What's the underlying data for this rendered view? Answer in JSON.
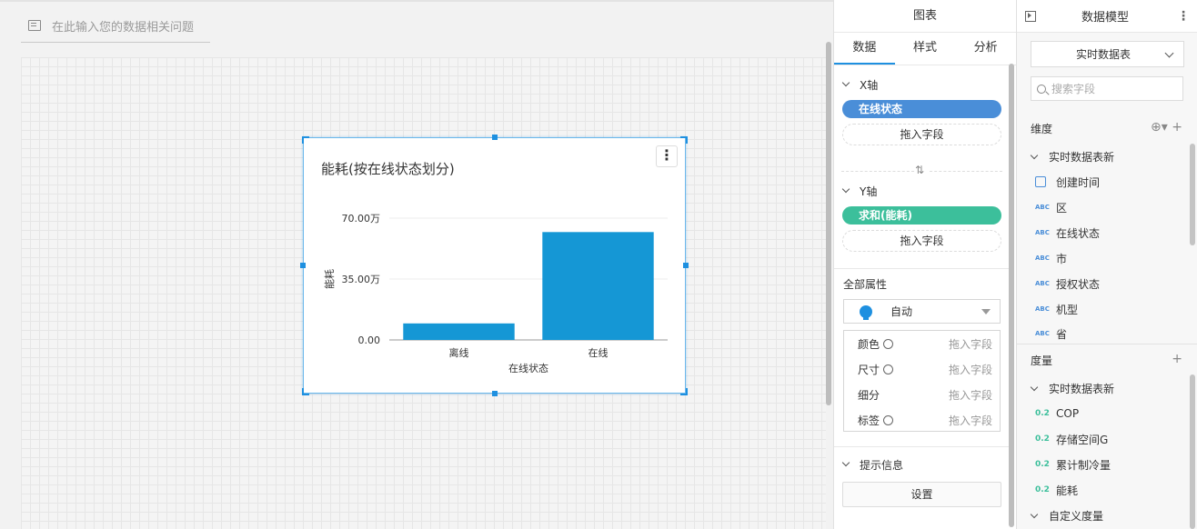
{
  "question": {
    "placeholder": "在此输入您的数据相关问题"
  },
  "chart_card": {
    "title": "能耗(按在线状态划分)",
    "menu_icon": "more-vertical-icon"
  },
  "chart_data": {
    "type": "bar",
    "title": "能耗(按在线状态划分)",
    "categories": [
      "离线",
      "在线"
    ],
    "values": [
      95000,
      620000
    ],
    "xlabel": "在线状态",
    "ylabel": "能耗",
    "ylim": [
      0,
      700000
    ],
    "yticks": [
      {
        "value": 0,
        "label": "0.00"
      },
      {
        "value": 350000,
        "label": "35.00万"
      },
      {
        "value": 700000,
        "label": "70.00万"
      }
    ],
    "bar_color": "#1597d5",
    "grid": true,
    "legend": "none"
  },
  "chart_panel": {
    "title": "图表",
    "tabs": [
      {
        "label": "数据"
      },
      {
        "label": "样式"
      },
      {
        "label": "分析"
      }
    ],
    "x_axis": {
      "label": "X轴",
      "field": "在线状态",
      "field_color": "#4a8ed8",
      "drop": "拖入字段"
    },
    "y_axis": {
      "label": "Y轴",
      "field": "求和(能耗)",
      "field_color": "#3cbf9b",
      "drop": "拖入字段"
    },
    "swap_icon": "swap-vertical-icon",
    "all_props": {
      "label": "全部属性",
      "auto_select": "自动",
      "rows": [
        {
          "label": "颜色",
          "hint": "拖入字段",
          "gear": true
        },
        {
          "label": "尺寸",
          "hint": "拖入字段",
          "gear": true
        },
        {
          "label": "细分",
          "hint": "拖入字段",
          "gear": false
        },
        {
          "label": "标签",
          "hint": "拖入字段",
          "gear": true
        }
      ]
    },
    "tooltip": {
      "label": "提示信息",
      "button": "设置"
    }
  },
  "model_panel": {
    "title": "数据模型",
    "table_select": "实时数据表",
    "search_placeholder": "搜索字段",
    "dimensions": {
      "label": "维度",
      "tools": "⊕▾ +",
      "group": "实时数据表新",
      "fields": [
        {
          "tag": "cal",
          "name": "创建时间"
        },
        {
          "tag": "ABC",
          "name": "区"
        },
        {
          "tag": "ABC",
          "name": "在线状态"
        },
        {
          "tag": "ABC",
          "name": "市"
        },
        {
          "tag": "ABC",
          "name": "授权状态"
        },
        {
          "tag": "ABC",
          "name": "机型"
        },
        {
          "tag": "ABC",
          "name": "省"
        }
      ]
    },
    "measures": {
      "label": "度量",
      "tools": "+",
      "group": "实时数据表新",
      "fields": [
        {
          "tag": "0.2",
          "name": "COP"
        },
        {
          "tag": "0.2",
          "name": "存储空间G"
        },
        {
          "tag": "0.2",
          "name": "累计制冷量"
        },
        {
          "tag": "0.2",
          "name": "能耗"
        }
      ],
      "group2": "自定义度量"
    }
  }
}
